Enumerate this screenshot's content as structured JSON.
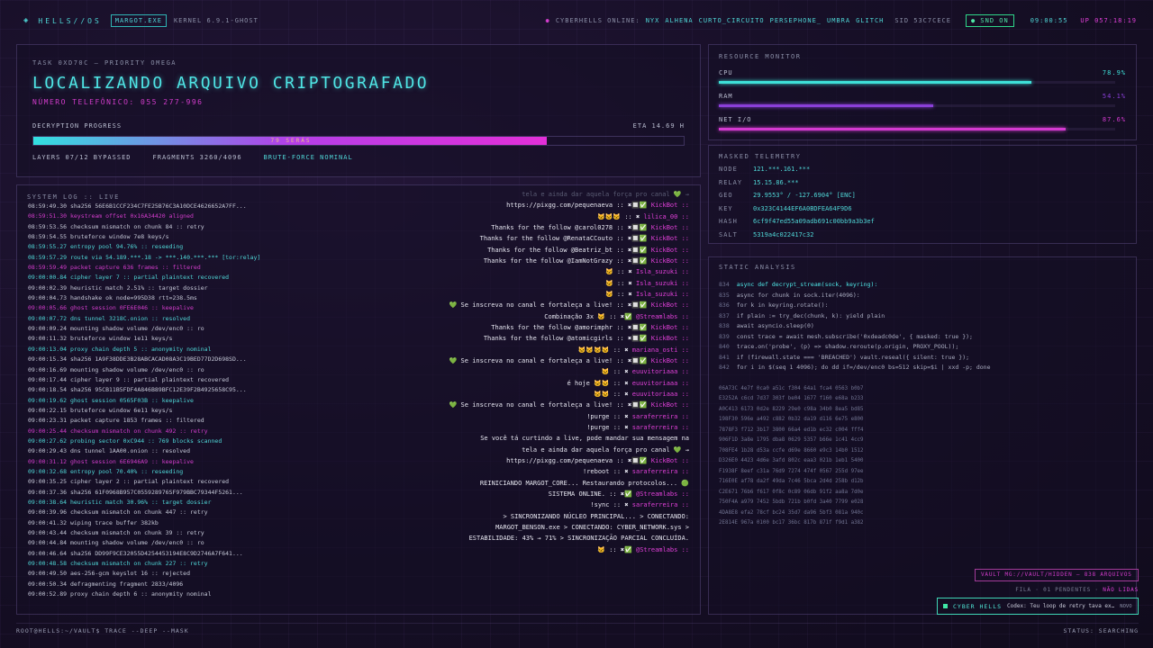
{
  "topbar": {
    "brand": "HELLS//OS",
    "host": "MARGOT.EXE",
    "kernel": "KERNEL 6.9.1-GHOST",
    "online_label": "CYBERHELLS ONLINE:",
    "users": [
      "NYX",
      "ALHENA",
      "CURTO_CIRCUITO",
      "PERSEPHONE_",
      "UMBRA",
      "GLITCH"
    ],
    "sid": "SID 53C7CECE",
    "snd": "SND ON",
    "clock": "09:00:55",
    "uptime": "UP 057:18:19"
  },
  "task": {
    "id": "TASK 0XD70C — PRIORITY OMEGA",
    "headline": "LOCALIZANDO ARQUIVO CRIPTOGRAFADO",
    "phone": "NÚMERO TELEFÔNICO: 055 277-996",
    "progress_label": "DECRYPTION PROGRESS",
    "eta": "ETA 14.69 H",
    "progress_pct": 79,
    "progress_text": "79 SERÁS",
    "layers": "LAYERS 07/12 BYPASSED",
    "fragments": "FRAGMENTS 3260/4096",
    "mode": "BRUTE-FORCE NOMINAL"
  },
  "log": {
    "title": "SYSTEM LOG :: LIVE",
    "lines": [
      {
        "t": "08:59:49.30 sha256 56E6B1CCF234C7FE25B76C3A10DCE4626652A7FF...",
        "c": "w"
      },
      {
        "t": "08:59:51.30 keystream offset 0x16A34420 aligned",
        "c": "m"
      },
      {
        "t": "08:59:53.56 checksum mismatch on chunk 84 :: retry",
        "c": "w"
      },
      {
        "t": "08:59:54.55 bruteforce window 7e8 keys/s",
        "c": "w"
      },
      {
        "t": "08:59:55.27 entropy pool 94.76% :: reseeding",
        "c": "t"
      },
      {
        "t": "08:59:57.29 route via 54.189.***.18 -> ***.140.***.*** [tor:relay]",
        "c": "t"
      },
      {
        "t": "08:59:59.49 packet capture 636 frames :: filtered",
        "c": "m"
      },
      {
        "t": "09:00:00.84 cipher layer 7 :: partial plaintext recovered",
        "c": "t"
      },
      {
        "t": "09:00:02.39 heuristic match 2.51% :: target dossier",
        "c": "w"
      },
      {
        "t": "09:00:04.73 handshake ok node=995D38 rtt=238.5ms",
        "c": "w"
      },
      {
        "t": "09:00:05.66 ghost session 0FE6E046 :: keepalive",
        "c": "m"
      },
      {
        "t": "09:00:07.72 dns tunnel 3218C.onion :: resolved",
        "c": "t"
      },
      {
        "t": "09:00:09.24 mounting shadow volume /dev/enc0 :: ro",
        "c": "w"
      },
      {
        "t": "09:00:11.32 bruteforce window 1e11 keys/s",
        "c": "w"
      },
      {
        "t": "09:00:13.04 proxy chain depth 5 :: anonymity nominal",
        "c": "t"
      },
      {
        "t": "09:00:15.34 sha256 1A9F38DDE3B28ABCACAD08A3C19BED77D2D698SD...",
        "c": "w"
      },
      {
        "t": "09:00:16.69 mounting shadow volume /dev/enc0 :: ro",
        "c": "w"
      },
      {
        "t": "09:00:17.44 cipher layer 9 :: partial plaintext recovered",
        "c": "w"
      },
      {
        "t": "09:00:18.54 sha256 95CB11B5FDF4A846B89BFC12E39F2B4925658C95...",
        "c": "w"
      },
      {
        "t": "09:00:19.62 ghost session 0565F03B :: keepalive",
        "c": "t"
      },
      {
        "t": "09:00:22.15 bruteforce window 6e11 keys/s",
        "c": "w"
      },
      {
        "t": "09:00:23.31 packet capture 1853 frames :: filtered",
        "c": "w"
      },
      {
        "t": "09:00:25.44 checksum mismatch on chunk 492 :: retry",
        "c": "m"
      },
      {
        "t": "09:00:27.62 probing sector 0xC944 :: 769 blocks scanned",
        "c": "t"
      },
      {
        "t": "09:00:29.43 dns tunnel 1AA00.onion :: resolved",
        "c": "w"
      },
      {
        "t": "09:00:31.12 ghost session 6E6946A9 :: keepalive",
        "c": "m"
      },
      {
        "t": "09:00:32.68 entropy pool 70.40% :: reseeding",
        "c": "t"
      },
      {
        "t": "09:00:35.25 cipher layer 2 :: partial plaintext recovered",
        "c": "w"
      },
      {
        "t": "09:00:37.36 sha256 61F0968B957C055928976SF979BBC79344F5261...",
        "c": "w"
      },
      {
        "t": "09:00:38.64 heuristic match 30.96% :: target dossier",
        "c": "t"
      },
      {
        "t": "09:00:39.96 checksum mismatch on chunk 447 :: retry",
        "c": "w"
      },
      {
        "t": "09:00:41.32 wiping trace buffer 382kb",
        "c": "w"
      },
      {
        "t": "09:00:43.44 checksum mismatch on chunk 39 :: retry",
        "c": "w"
      },
      {
        "t": "09:00:44.84 mounting shadow volume /dev/enc0 :: ro",
        "c": "w"
      },
      {
        "t": "09:00:46.64 sha256 DD99F9CE32055D4254453194E8C9D2746A7F641...",
        "c": "w"
      },
      {
        "t": "09:00:48.58 checksum mismatch on chunk 227 :: retry",
        "c": "t"
      },
      {
        "t": "09:00:49.50 aes-256-gcm keyslot 16 :: rejected",
        "c": "w"
      },
      {
        "t": "09:00:50.34 defragmenting fragment 2833/4096",
        "c": "w"
      },
      {
        "t": "09:00:52.89 proxy chain depth 6 :: anonymity nominal",
        "c": "w"
      }
    ]
  },
  "chat": [
    {
      "m": "tela e ainda dar aquela força pro canal 💚 →",
      "u": "",
      "c": "f"
    },
    {
      "m": "https://pixgg.com/pequenaeva :: ✖🔲✅",
      "u": "KickBot",
      "c": "b"
    },
    {
      "m": "🐱🐱🐱 :: ✖",
      "u": "lilica_00",
      "c": "u"
    },
    {
      "m": "Thanks for the follow @carol0278 :: ✖🔲✅",
      "u": "KickBot",
      "c": "b"
    },
    {
      "m": "Thanks for the follow @RenataCCouto :: ✖🔲✅",
      "u": "KickBot",
      "c": "b"
    },
    {
      "m": "Thanks for the follow @Beatriz_bt :: ✖🔲✅",
      "u": "KickBot",
      "c": "b"
    },
    {
      "m": "Thanks for the follow @IamNotGrazy :: ✖🔲✅",
      "u": "KickBot",
      "c": "b"
    },
    {
      "m": "🐱 :: ✖",
      "u": "Isla_suzuki",
      "c": "u"
    },
    {
      "m": "🐱 :: ✖",
      "u": "Isla_suzuki",
      "c": "u"
    },
    {
      "m": "🐱 :: ✖",
      "u": "Isla_suzuki",
      "c": "u"
    },
    {
      "m": "💚 Se inscreva no canal e fortaleça a live! :: ✖🔲✅",
      "u": "KickBot",
      "c": "b"
    },
    {
      "m": "Combinação 3x 🐱 :: ✖✅",
      "u": "@Streamlabs",
      "c": "b"
    },
    {
      "m": "Thanks for the follow @amorimphr :: ✖🔲✅",
      "u": "KickBot",
      "c": "b"
    },
    {
      "m": "Thanks for the follow @atomicgirls :: ✖🔲✅",
      "u": "KickBot",
      "c": "b"
    },
    {
      "m": "🐱🐱🐱🐱 :: ✖",
      "u": "mariana_osti",
      "c": "u"
    },
    {
      "m": "💚 Se inscreva no canal e fortaleça a live! :: ✖🔲✅",
      "u": "KickBot",
      "c": "b"
    },
    {
      "m": "🐱 :: ✖",
      "u": "euuvitoriaaa",
      "c": "u"
    },
    {
      "m": "é hoje 🐱🐱 :: ✖",
      "u": "euuvitoriaaa",
      "c": "u"
    },
    {
      "m": "🐱🐱 :: ✖",
      "u": "euuvitoriaaa",
      "c": "u"
    },
    {
      "m": "💚 Se inscreva no canal e fortaleça a live! :: ✖🔲✅",
      "u": "KickBot",
      "c": "b"
    },
    {
      "m": "!purge :: ✖",
      "u": "saraferreira",
      "c": "u"
    },
    {
      "m": "!purge :: ✖",
      "u": "saraferreira",
      "c": "u"
    },
    {
      "m": "Se você tá curtindo a live, pode mandar sua mensagem na",
      "u": "",
      "c": "n"
    },
    {
      "m": "tela e ainda dar aquela força pro canal 💚 →",
      "u": "",
      "c": "n"
    },
    {
      "m": "https://pixgg.com/pequenaeva :: ✖🔲✅",
      "u": "KickBot",
      "c": "b"
    },
    {
      "m": "!reboot :: ✖",
      "u": "saraferreira",
      "c": "u"
    },
    {
      "m": "REINICIANDO MARGOT_CORE... Restaurando protocolos... 🟢",
      "u": "",
      "c": "n"
    },
    {
      "m": "SISTEMA ONLINE. :: ✖✅",
      "u": "@Streamlabs",
      "c": "b"
    },
    {
      "m": "!sync :: ✖",
      "u": "saraferreira",
      "c": "u"
    },
    {
      "m": "> SINCRONIZANDO NÚCLEO PRINCIPAL... > CONECTANDO:",
      "u": "",
      "c": "n"
    },
    {
      "m": "MARGOT_BENSON.exe > CONECTANDO: CYBER_NETWORK.sys >",
      "u": "",
      "c": "n"
    },
    {
      "m": "ESTABILIDADE: 43% → 71% > SINCRONIZAÇÃO PARCIAL CONCLUÍDA.",
      "u": "",
      "c": "n"
    },
    {
      "m": "🐱 :: ✖✅",
      "u": "@Streamlabs",
      "c": "b"
    }
  ],
  "resources": {
    "title": "RESOURCE MONITOR",
    "metrics": [
      {
        "name": "CPU",
        "value": "78.9%",
        "pct": 78.9,
        "color": "#3ee0d8"
      },
      {
        "name": "RAM",
        "value": "54.1%",
        "pct": 54.1,
        "color": "#8a3fd8"
      },
      {
        "name": "NET I/O",
        "value": "87.6%",
        "pct": 87.6,
        "color": "#d43ad0"
      }
    ]
  },
  "telemetry": {
    "title": "MASKED TELEMETRY",
    "rows": [
      {
        "k": "NODE",
        "v": "121.***.161.***"
      },
      {
        "k": "RELAY",
        "v": "15.15.86.***"
      },
      {
        "k": "GEO",
        "v": "29.9553° / -127.6904° [ENC]"
      },
      {
        "k": "KEY",
        "v": "0x323C4144EF6A0BDFEA64F9D6"
      },
      {
        "k": "HASH",
        "v": "6cf9f47ed55a09adb691c00bb9a3b3ef"
      },
      {
        "k": "SALT",
        "v": "5319a4c022417c32"
      }
    ]
  },
  "static": {
    "title": "STATIC ANALYSIS",
    "code": [
      {
        "n": "834",
        "t": "async def decrypt_stream(sock, keyring):",
        "hl": true
      },
      {
        "n": "835",
        "t": "async for chunk in sock.iter(4096):",
        "hl": false
      },
      {
        "n": "836",
        "t": "for k in keyring.rotate():",
        "hl": false
      },
      {
        "n": "837",
        "t": "if plain := try_dec(chunk, k): yield plain",
        "hl": false
      },
      {
        "n": "838",
        "t": "await asyncio.sleep(0)",
        "hl": false
      },
      {
        "n": "839",
        "t": "const trace = await mesh.subscribe('0xdeadc0de', { masked: true });",
        "hl": false
      },
      {
        "n": "840",
        "t": "trace.on('probe', (p) => shadow.reroute(p.origin, PROXY_POOL));",
        "hl": false
      },
      {
        "n": "841",
        "t": "if (firewall.state === 'BREACHED') vault.reseal({ silent: true });",
        "hl": false
      },
      {
        "n": "842",
        "t": "for i in $(seq 1 4096); do dd if=/dev/enc0 bs=512 skip=$i | xxd -p; done",
        "hl": false
      }
    ],
    "hex": [
      "06A73C 4e7f 0ca0 a51c f304 64a1 fca4 0563 b0b7",
      "E3252A c6cd 7d37 303f be04 1677 f160 e68a b233",
      "A0C413 6173 0d2e 8229 29e0 c98a 34b0 8ea5 bd85",
      "198F30 596e a492 c882 0b32 da19 d116 6e75 e800",
      "7878F3 f712 3b17 3800 66a4 ed1b ec32 c004 fff4",
      "906F1D 3a8e 1795 dba8 0629 5357 b66e 1c41 4cc9",
      "708FE4 1b28 d53a ccfe d69e 8660 e9c3 14b0 1512",
      "D326E0 4423 4d6e 3afd 802c eaa3 021b 1eb1 5400",
      "F1938F 8eef c31a 76d9 7274 474f 0567 255d 97ee",
      "716E0E af78 da2f 49da 7c46 5bca 2d4d 258b d12b",
      "C2E671 76b6 f617 0f8c 0c89 06db 91f2 aa8a 7d0e",
      "750F4A a979 7452 5bdb 721b b0fd 3a40 7799 e028",
      "4DA8E8 efa2 78cf bc24 35d7 da96 5bf3 081a 940c",
      "2E814E 967a 0100 bc17 36bc 817b 871f f9d1 a382"
    ]
  },
  "vault": "VAULT MG://VAULT/HIDDEN — 838 ARQUIVOS",
  "fila": {
    "label": "FILA · 01 PENDENTES ·",
    "status": "NÃO LIDAS"
  },
  "toast": {
    "name": "CYBER HELLS",
    "text": "Codex: Teu loop de retry tava ex…",
    "tag": "NOVO"
  },
  "bottom": {
    "prompt": "ROOT@HELLS:~/VAULT$ TRACE --DEEP --MASK",
    "status": "STATUS: SEARCHING"
  }
}
